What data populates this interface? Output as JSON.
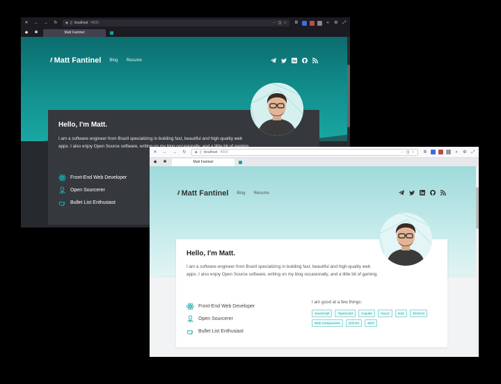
{
  "windows": {
    "dark": {
      "url": {
        "host": "localhost",
        "port": ":4000"
      },
      "tab_title": "Matt Fantinel",
      "nav": {
        "logo": "Matt Fantinel",
        "links": [
          "Blog",
          "Resume"
        ]
      },
      "card": {
        "title": "Hello, I'm Matt.",
        "bio": "I am a software engineer from Brazil specializing in building fast, beautiful and high-quality web apps. I also enjoy Open Source software, writing on my blog occasionally, and a little bit of gaming.",
        "things": [
          "Front-End Web Developer",
          "Open Sourcerer",
          "Bullet List Enthusiast"
        ]
      }
    },
    "light": {
      "url": {
        "host": "localhost",
        "port": ":4000"
      },
      "tab_title": "Matt Fantinel",
      "nav": {
        "logo": "Matt Fantinel",
        "links": [
          "Blog",
          "Resume"
        ]
      },
      "card": {
        "title": "Hello, I'm Matt.",
        "bio": "I am a software engineer from Brazil specializing in building fast, beautiful and high-quality web apps. I also enjoy Open Source software, writing on my blog occasionally, and a little bit of gaming.",
        "things": [
          "Front-End Web Developer",
          "Open Sourcerer",
          "Bullet List Enthusiast"
        ],
        "skills_label": "I am good at a few things:",
        "skills": [
          "JavaScript",
          "TypeScript",
          "Angular",
          "Vue.js",
          "Ionic",
          "Electron",
          "Web Components",
          "(S)CSS",
          "SEO"
        ]
      }
    }
  },
  "icons": {
    "socials": [
      "telegram-icon",
      "twitter-icon",
      "linkedin-icon",
      "github-icon",
      "rss-icon"
    ],
    "things": [
      "react-atom-icon",
      "open-source-icon",
      "hand-pointing-icon"
    ]
  },
  "colors": {
    "accent": "#17a2a2",
    "dark_card": "#35383d",
    "light_card": "#ffffff"
  }
}
